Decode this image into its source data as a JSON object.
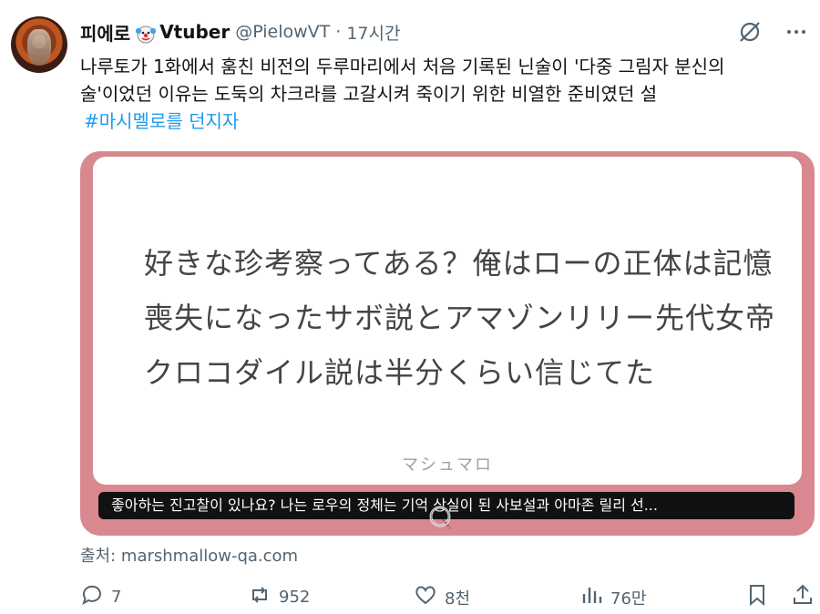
{
  "tweet": {
    "display_name": "피에로",
    "name_suffix": "Vtuber",
    "handle": "@PielowVT",
    "separator": "·",
    "time": "17시간",
    "text_line1": "나루토가 1화에서 훔친 비전의 두루마리에서 처음 기록된 닌술이 '다중 그림자 분신의",
    "text_line2": "술'이었던 이유는 도둑의 차크라를 고갈시켜 죽이기 위한 비열한 준비였던 설",
    "hashtag": "#마시멜로를 던지자"
  },
  "card": {
    "jp_line1": "好きな珍考察ってある？俺はローの正体は記憶",
    "jp_line2": "喪失になったサボ説とアマゾンリリー先代女帝",
    "jp_line3": "クロコダイル説は半分くらい信じてた",
    "brand": "マシュマロ",
    "caption": "좋아하는 진고찰이 있나요? 나는 로우의 정체는 기억 상실이 된 사보설과 아마존 릴리 선..."
  },
  "source": "출처: marshmallow-qa.com",
  "actions": {
    "replies": "7",
    "retweets": "952",
    "likes": "8천",
    "views": "76만"
  },
  "colors": {
    "card_border": "#d9888f",
    "hashtag": "#1d9bf0",
    "muted": "#536471"
  },
  "icons": [
    "grok-icon",
    "more-icon",
    "reply-icon",
    "retweet-icon",
    "like-icon",
    "views-icon",
    "bookmark-icon",
    "share-icon",
    "clown-emoji-icon"
  ]
}
